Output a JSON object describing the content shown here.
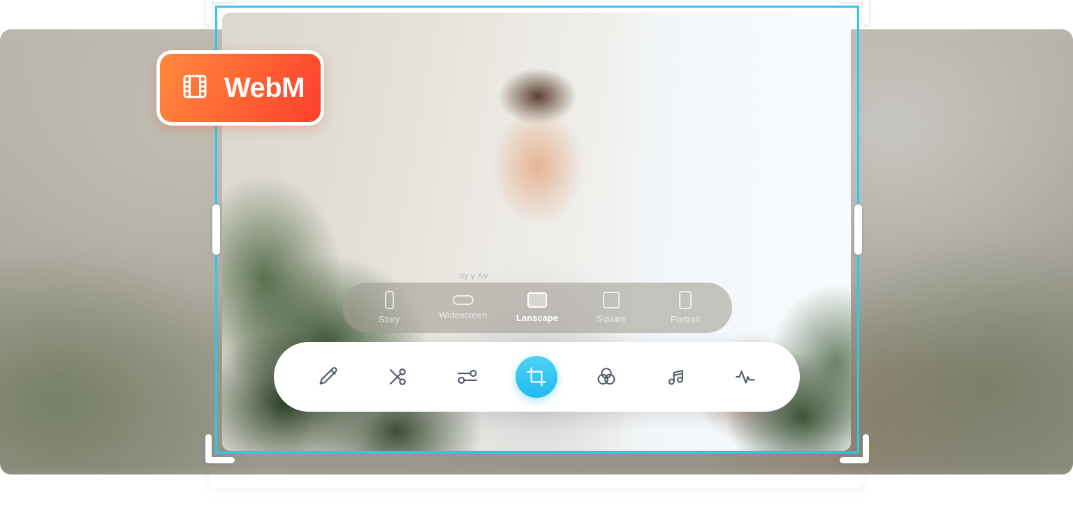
{
  "badge": {
    "label": "WebM",
    "icon": "film-strip-icon",
    "gradient_from": "#ff8a3d",
    "gradient_to": "#fb3f2e"
  },
  "photo": {
    "watermark": "0y y ΛV"
  },
  "crop": {
    "border_color": "#2cc8f5",
    "handles": [
      "corner-top-left",
      "corner-top-right",
      "corner-bottom-left",
      "corner-bottom-right",
      "edge-left",
      "edge-right"
    ]
  },
  "aspect_bar": {
    "items": [
      {
        "label": "Story",
        "icon": "aspect-story-icon",
        "active": false
      },
      {
        "label": "Widescreen",
        "icon": "aspect-widescreen-icon",
        "active": false
      },
      {
        "label": "Lanscape",
        "icon": "aspect-landscape-icon",
        "active": true
      },
      {
        "label": "Square",
        "icon": "aspect-square-icon",
        "active": false
      },
      {
        "label": "Portrait",
        "icon": "aspect-portrait-icon",
        "active": false
      }
    ]
  },
  "toolbar": {
    "active_color": "#23b9ef",
    "icon_color": "#4e586b",
    "tools": [
      {
        "name": "edit-pencil",
        "icon": "pencil-icon",
        "active": false
      },
      {
        "name": "trim-cut",
        "icon": "scissors-icon",
        "active": false
      },
      {
        "name": "adjust",
        "icon": "sliders-icon",
        "active": false
      },
      {
        "name": "crop",
        "icon": "crop-icon",
        "active": true
      },
      {
        "name": "filters",
        "icon": "color-mix-icon",
        "active": false
      },
      {
        "name": "audio",
        "icon": "music-note-icon",
        "active": false
      },
      {
        "name": "effects",
        "icon": "waveform-icon",
        "active": false
      }
    ]
  }
}
